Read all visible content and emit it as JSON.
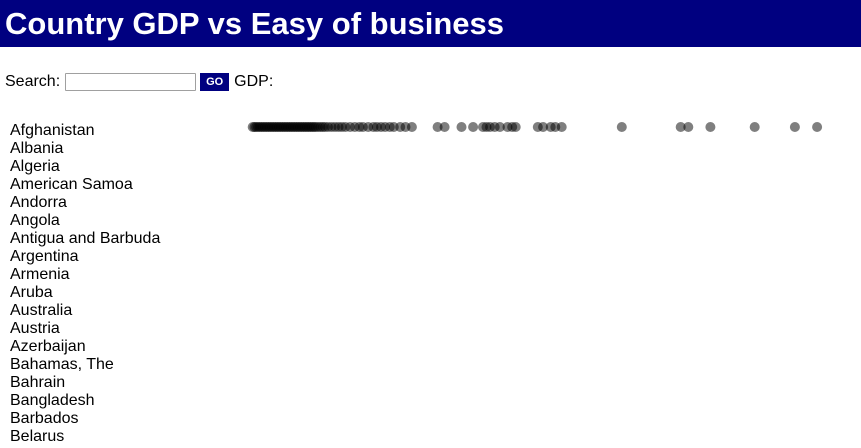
{
  "header": {
    "title": "Country GDP vs Easy of business"
  },
  "search": {
    "label": "Search:",
    "value": "",
    "placeholder": "",
    "go_label": "GO",
    "metric_label": "GDP:"
  },
  "countries": [
    "Afghanistan",
    "Albania",
    "Algeria",
    "American Samoa",
    "Andorra",
    "Angola",
    "Antigua and Barbuda",
    "Argentina",
    "Armenia",
    "Aruba",
    "Australia",
    "Austria",
    "Azerbaijan",
    "Bahamas, The",
    "Bahrain",
    "Bangladesh",
    "Barbados",
    "Belarus"
  ],
  "dot_color": "#000000",
  "dot_opacity": 0.5,
  "gdp_strip": {
    "values": [
      0.3,
      0.6,
      0.9,
      1.2,
      1.5,
      1.8,
      2.1,
      2.4,
      2.7,
      3.0,
      3.3,
      3.6,
      3.9,
      4.2,
      4.5,
      4.8,
      5.1,
      5.4,
      5.7,
      6.0,
      6.3,
      6.6,
      6.9,
      7.2,
      7.5,
      7.8,
      8.1,
      8.4,
      8.7,
      9.0,
      9.3,
      9.6,
      9.9,
      10.2,
      10.5,
      10.8,
      11.1,
      11.5,
      11.9,
      12.3,
      12.7,
      13.2,
      13.8,
      14.4,
      15.0,
      15.6,
      16.2,
      17.0,
      17.8,
      18.6,
      19.2,
      20.1,
      21.0,
      21.6,
      22.3,
      23.0,
      23.8,
      24.5,
      25.6,
      26.5,
      27.6,
      32.0,
      33.2,
      36.1,
      38.1,
      39.8,
      40.4,
      41.0,
      41.8,
      42.7,
      44.0,
      44.8,
      45.4,
      49.2,
      50.1,
      51.4,
      52.2,
      53.3,
      63.6,
      73.7,
      75.0,
      78.8,
      86.4,
      93.3,
      97.1
    ]
  }
}
